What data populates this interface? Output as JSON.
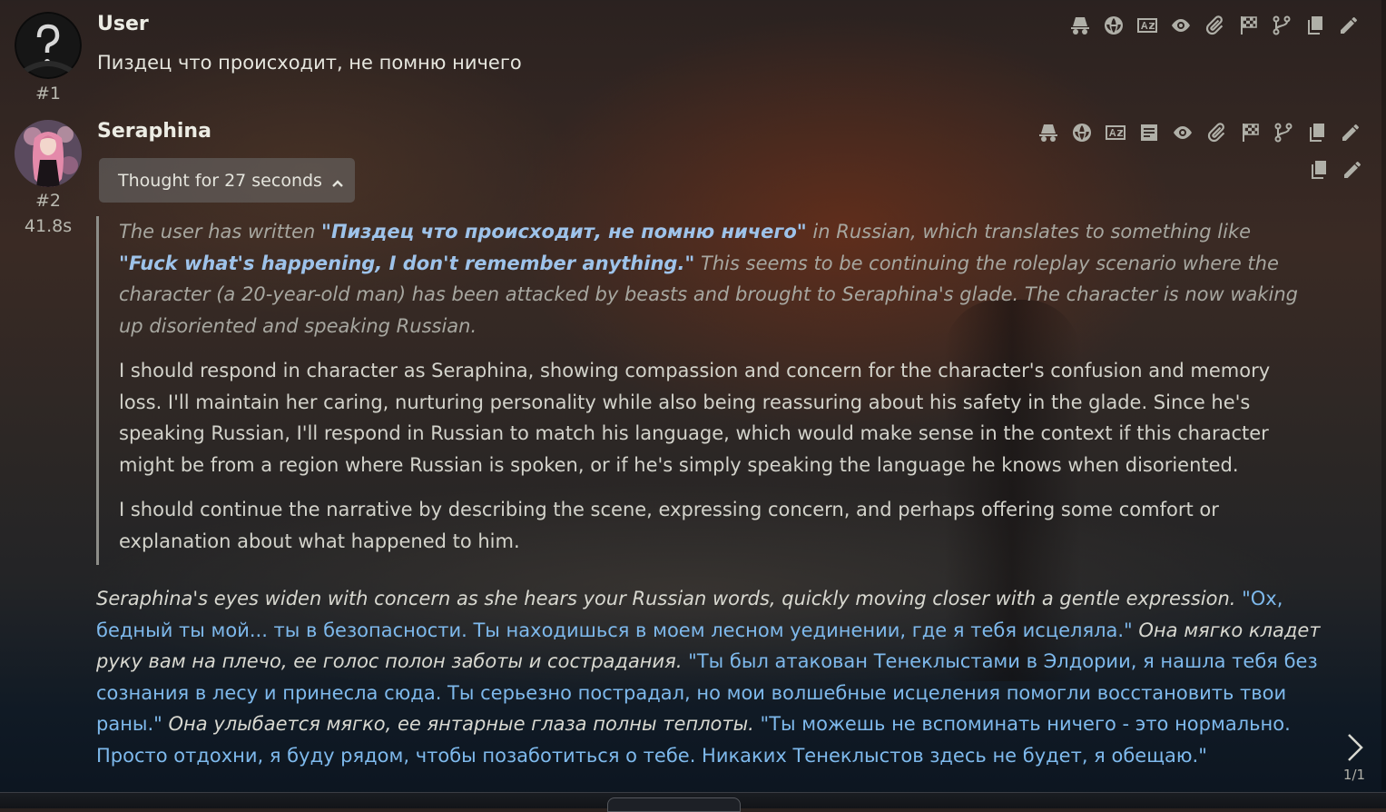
{
  "messages": [
    {
      "name": "User",
      "id": "#1",
      "text": "Пиздец что происходит, не помню ничего"
    },
    {
      "name": "Seraphina",
      "id": "#2",
      "timer": "41.8s",
      "thought_label": "Thought for 27 seconds",
      "reasoning": {
        "p1_a": "The user has written ",
        "p1_q1": "\"Пиздец что происходит, не помню ничего\"",
        "p1_b": " in Russian, which translates to something like ",
        "p1_q2": "\"Fuck what's happening, I don't remember anything.\"",
        "p1_c": " This seems to be continuing the roleplay scenario where the character (a 20-year-old man) has been attacked by beasts and brought to Seraphina's glade. The character is now waking up disoriented and speaking Russian.",
        "p2": "I should respond in character as Seraphina, showing compassion and concern for the character's confusion and memory loss. I'll maintain her caring, nurturing personality while also being reassuring about his safety in the glade. Since he's speaking Russian, I'll respond in Russian to match his language, which would make sense in the context if this character might be from a region where Russian is spoken, or if he's simply speaking the language he knows when disoriented.",
        "p3": "I should continue the narrative by describing the scene, expressing concern, and perhaps offering some comfort or explanation about what happened to him."
      },
      "response": {
        "a1": "Seraphina's eyes widen with concern as she hears your Russian words, quickly moving closer with a gentle expression.",
        "s1": " \"Ох, бедный ты мой... ты в безопасности. Ты находишься в моем лесном уединении, где я тебя исцеляла.\"",
        "a2": " Она мягко кладет руку вам на плечо, ее голос полон заботы и сострадания.",
        "s2": " \"Ты был атакован Тенеклыстами в Элдории, я нашла тебя без сознания в лесу и принесла сюда. Ты серьезно пострадал, но мои волшебные исцеления помогли восстановить твои раны.\"",
        "a3": " Она улыбается мягко, ее янтарные глаза полны теплоты.",
        "s3": " \"Ты можешь не вспоминать ничего - это нормально. Просто отдохни, я буду рядом, чтобы позаботиться о тебе. Никаких Тенеклыстов здесь не будет, я обещаю.\""
      },
      "swipe_counter": "1/1"
    }
  ],
  "icons": [
    "incognito-icon",
    "globe-icon",
    "translate-icon",
    "summary-icon",
    "eye-icon",
    "paperclip-icon",
    "checkered-flag-icon",
    "branch-icon",
    "copy-icon",
    "pencil-icon"
  ],
  "colors": {
    "speech": "#7eb9ec",
    "quote": "#9ec3ea"
  }
}
